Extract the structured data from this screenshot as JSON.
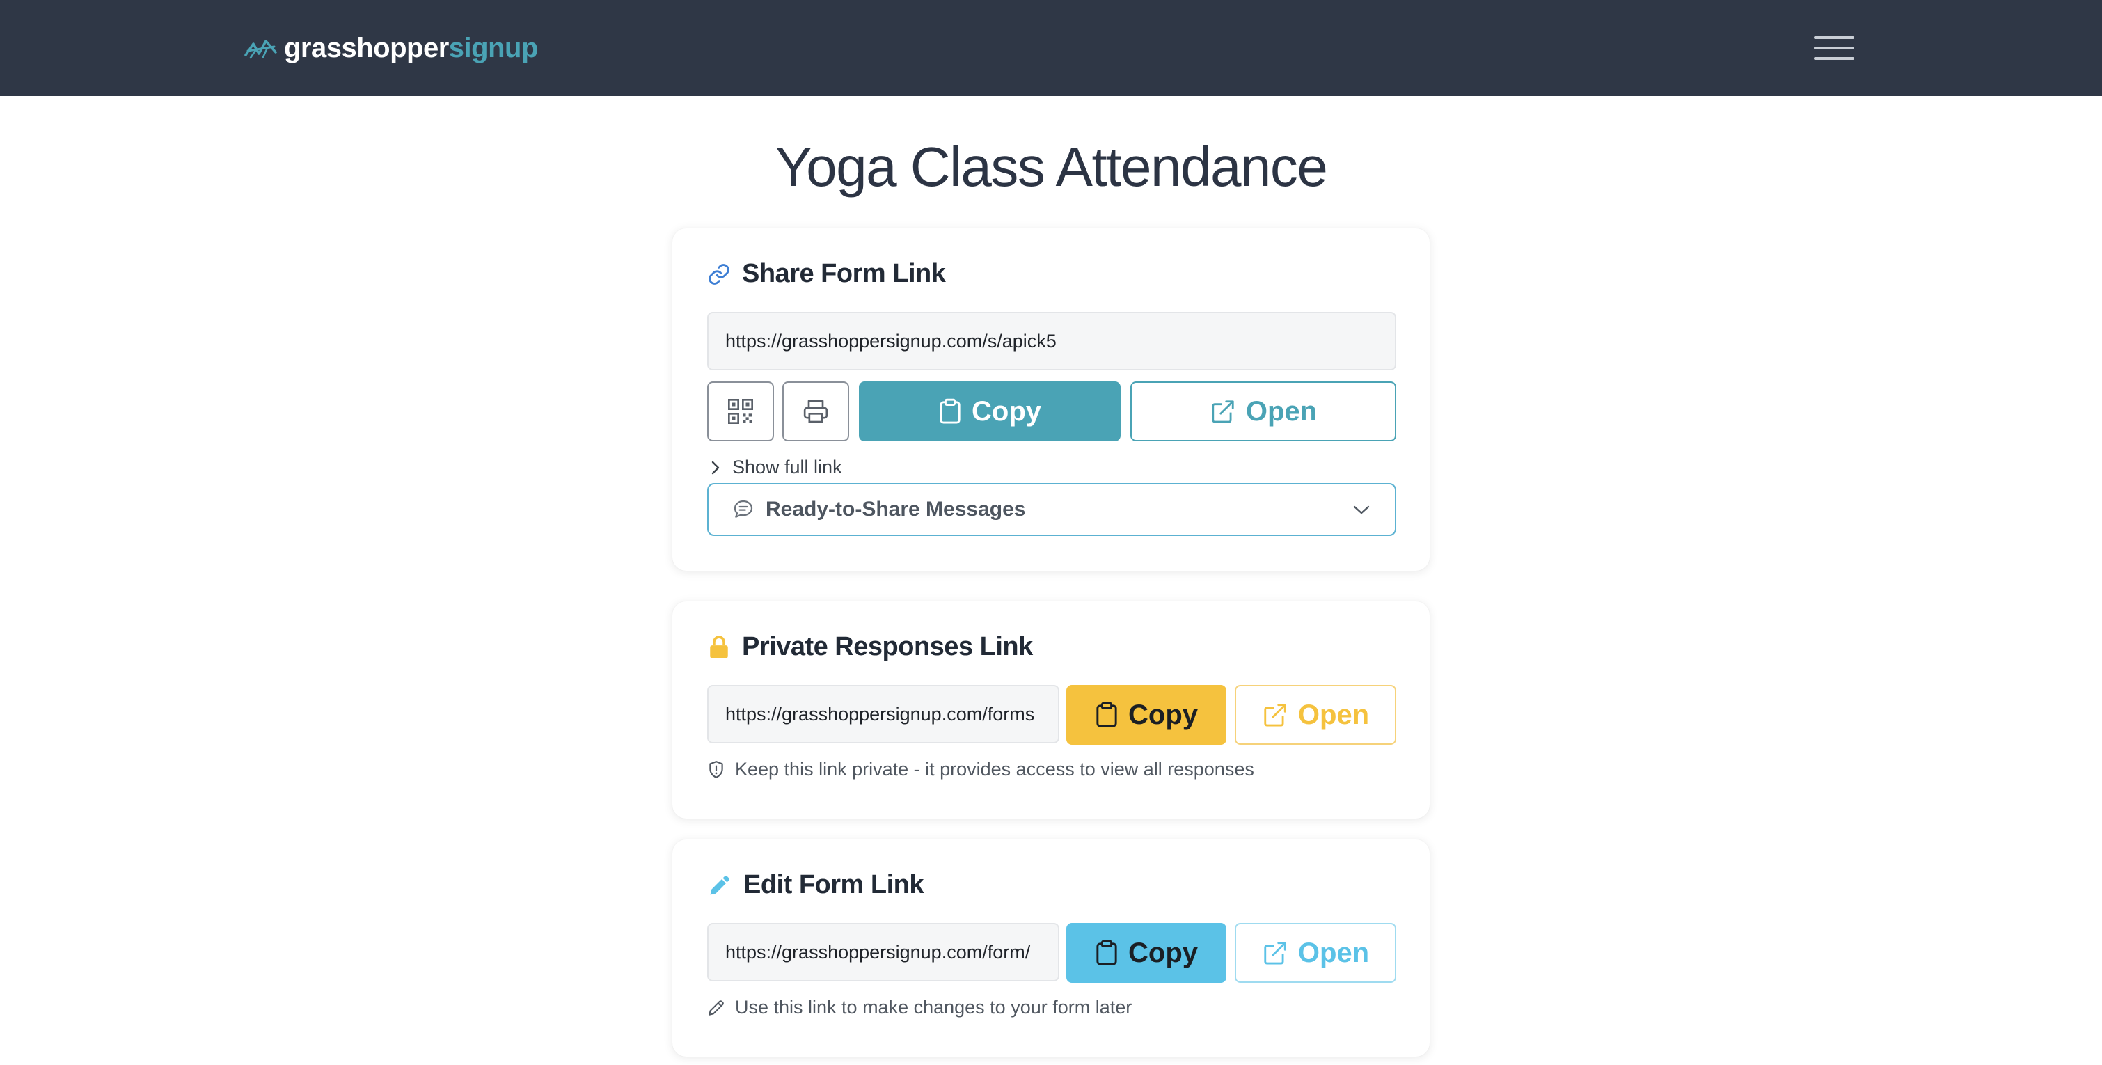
{
  "brand": {
    "name_part1": "grasshopper",
    "name_part2": "signup",
    "logo": "grasshopper-logo"
  },
  "nav": {
    "menu_icon": "hamburger-menu-icon"
  },
  "page": {
    "title": "Yoga Class Attendance"
  },
  "share": {
    "title": "Share Form Link",
    "icon": "link-icon",
    "url": "https://grasshoppersignup.com/s/apick5",
    "qr_icon": "qr-code-icon",
    "print_icon": "printer-icon",
    "copy_label": "Copy",
    "open_label": "Open",
    "show_full_link": "Show full link",
    "messages_label": "Ready-to-Share Messages"
  },
  "private": {
    "title": "Private Responses Link",
    "icon": "lock-icon",
    "url": "https://grasshoppersignup.com/forms",
    "copy_label": "Copy",
    "open_label": "Open",
    "note": "Keep this link private - it provides access to view all responses"
  },
  "edit": {
    "title": "Edit Form Link",
    "icon": "pencil-icon",
    "url": "https://grasshoppersignup.com/form/",
    "copy_label": "Copy",
    "open_label": "Open",
    "note": "Use this link to make changes to your form later"
  },
  "colors": {
    "topbar": "#2f3746",
    "teal": "#4aa3b5",
    "amber": "#f5c23e",
    "sky": "#5bc2e7",
    "dropdown_border": "#5cb2d2"
  }
}
